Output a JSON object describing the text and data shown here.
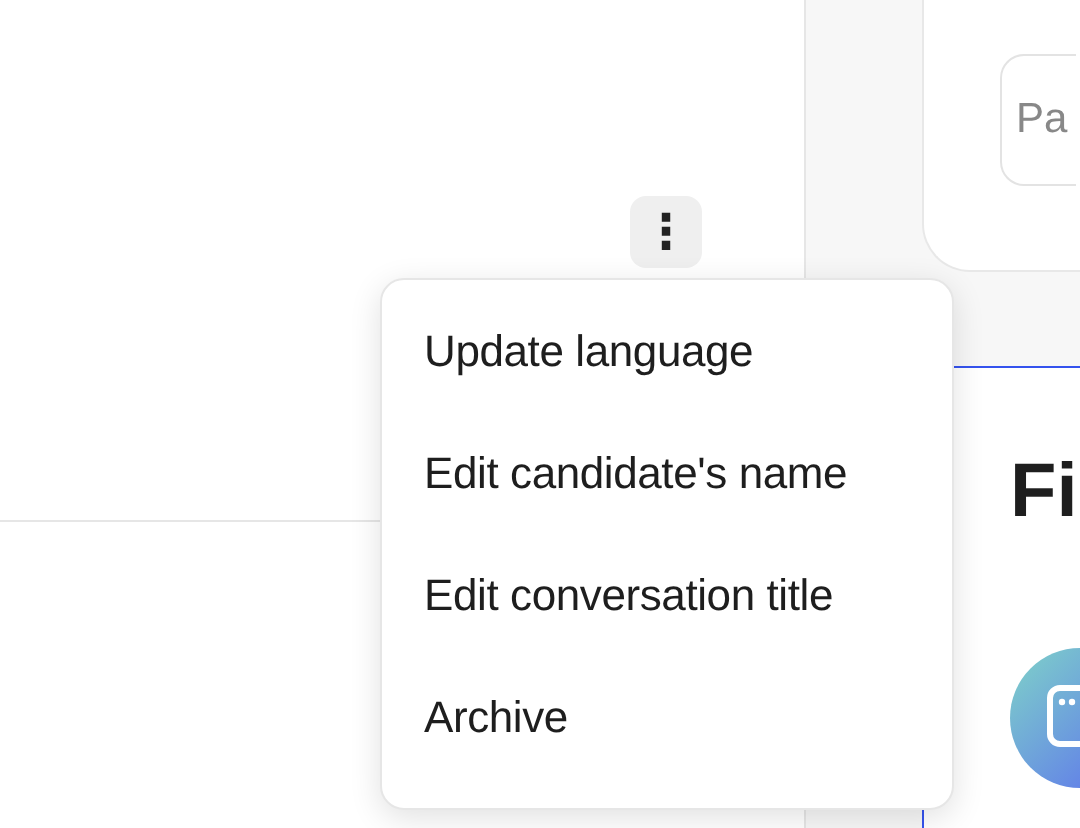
{
  "more_button": {
    "label": "⋮",
    "expanded": true
  },
  "menu": {
    "items": [
      {
        "label": "Update language"
      },
      {
        "label": "Edit candidate's name"
      },
      {
        "label": "Edit conversation title"
      },
      {
        "label": "Archive"
      }
    ]
  },
  "side_panel": {
    "field": {
      "placeholder": "Pa"
    },
    "section_title": "Fi"
  }
}
